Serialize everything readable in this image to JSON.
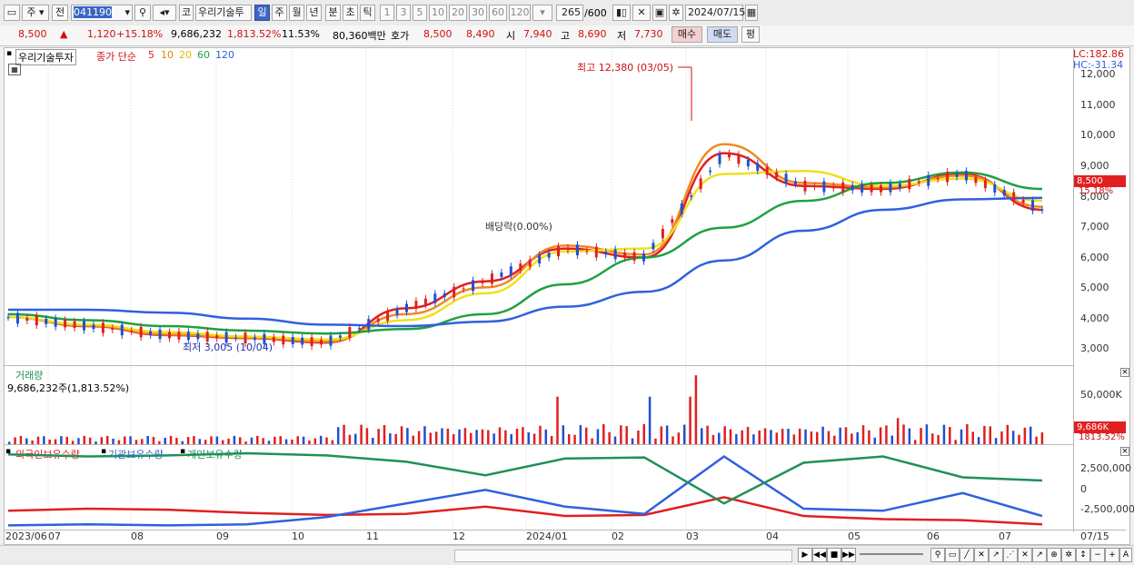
{
  "toolbar": {
    "market_label": "주",
    "prev_label": "전",
    "stock_code": "041190",
    "code_label": "코",
    "stock_name": "우리기술투",
    "period_tabs": [
      "일",
      "주",
      "월",
      "년",
      "분",
      "초",
      "틱"
    ],
    "period_selected": "일",
    "interval_buttons": [
      "1",
      "3",
      "5",
      "10",
      "20",
      "30",
      "60",
      "120"
    ],
    "count_value": "265",
    "count_max": "/600",
    "date_value": "2024/07/15"
  },
  "quote": {
    "price": "8,500",
    "change": "1,120",
    "change_pct": "+15.18%",
    "volume": "9,686,232",
    "volume_ratio": "1,813.52%",
    "turnover": "11.53%",
    "amount": "80,360백만",
    "bid_label": "호가",
    "bid1": "8,500",
    "bid2": "8,490",
    "open_label": "시",
    "open": "7,940",
    "high_label": "고",
    "high": "8,690",
    "low_label": "저",
    "low": "7,730",
    "buy_label": "매수",
    "sell_label": "매도",
    "eval_label": "평"
  },
  "price_pane": {
    "title": "우리기술투자",
    "ma_label": "종가 단순",
    "ma_periods": [
      "5",
      "10",
      "20",
      "60",
      "120"
    ],
    "ma_colors": [
      "#e02020",
      "#f08a20",
      "#f0e020",
      "#20a040",
      "#3060e0"
    ],
    "lc_label": "LC:182.86",
    "hc_label": "HC:-31.34",
    "high_annotation": "최고 12,380 (03/05)",
    "low_annotation": "최저 3,005 (10/04)",
    "dividend_annotation": "배당락(0.00%)",
    "current_price_tag": "8,500",
    "current_pct_tag": "15.18%",
    "y_ticks": [
      "12,000",
      "11,000",
      "10,000",
      "9,000",
      "8,000",
      "7,000",
      "6,000",
      "5,000",
      "4,000",
      "3,000"
    ]
  },
  "volume_pane": {
    "title": "거래량",
    "value": "9,686,232주(1,813.52%)",
    "y_tick": "50,000K",
    "tag_value": "9,686K",
    "tag_pct": "1813.52%"
  },
  "holding_pane": {
    "series_labels": [
      "외국인보유수량",
      "기관보유수량",
      "개인보유수량"
    ],
    "series_colors": [
      "#e02020",
      "#3060e0",
      "#20905a"
    ],
    "y_ticks": [
      "2,500,000",
      "0",
      "-2,500,000"
    ]
  },
  "x_axis": {
    "labels": [
      "2023/06",
      "07",
      "08",
      "09",
      "10",
      "11",
      "12",
      "2024/01",
      "02",
      "03",
      "04",
      "05",
      "06",
      "07",
      "07/15"
    ]
  },
  "chart_data": {
    "type": "line",
    "title": "우리기술투자",
    "x": [
      "2023/06",
      "07",
      "08",
      "09",
      "10",
      "11",
      "12",
      "2024/01",
      "02",
      "03",
      "04",
      "05",
      "06",
      "07"
    ],
    "ylim": [
      2600,
      12600
    ],
    "series": [
      {
        "name": "5",
        "values": [
          4000,
          3700,
          3400,
          3300,
          3150,
          4300,
          5200,
          6300,
          6000,
          9500,
          8400,
          8300,
          8800,
          7600
        ]
      },
      {
        "name": "10",
        "values": [
          4000,
          3720,
          3420,
          3320,
          3180,
          4100,
          5000,
          6400,
          6100,
          9800,
          8500,
          8350,
          8750,
          7700
        ]
      },
      {
        "name": "20",
        "values": [
          4000,
          3750,
          3500,
          3350,
          3250,
          3900,
          4800,
          6200,
          6300,
          8800,
          8900,
          8400,
          8650,
          7900
        ]
      },
      {
        "name": "60",
        "values": [
          4100,
          3900,
          3700,
          3550,
          3450,
          3600,
          4100,
          5100,
          6000,
          7000,
          7900,
          8500,
          8850,
          8300
        ]
      },
      {
        "name": "120",
        "values": [
          4250,
          4250,
          4150,
          3950,
          3750,
          3700,
          3850,
          4350,
          4850,
          5900,
          6900,
          7600,
          7950,
          8000
        ]
      }
    ],
    "volume_ylim": [
      0,
      65000
    ],
    "holding_ylim": [
      -4000000,
      4000000
    ]
  }
}
